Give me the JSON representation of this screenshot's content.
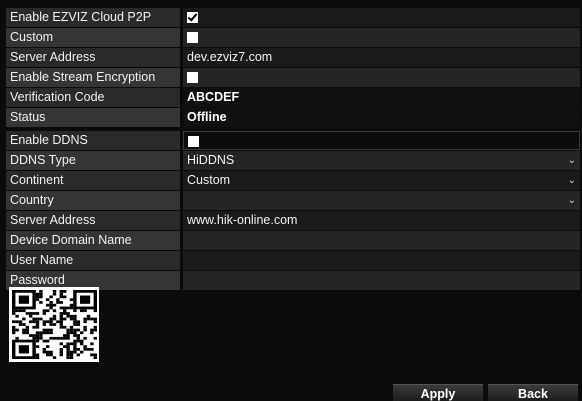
{
  "p2p": {
    "enable_label": "Enable EZVIZ Cloud P2P",
    "enable_checked": true,
    "custom_label": "Custom",
    "custom_checked": false,
    "server_label": "Server Address",
    "server_value": "dev.ezviz7.com",
    "encrypt_label": "Enable Stream Encryption",
    "encrypt_checked": false,
    "verify_label": "Verification Code",
    "verify_value": "ABCDEF",
    "status_label": "Status",
    "status_value": "Offline"
  },
  "ddns": {
    "enable_label": "Enable DDNS",
    "enable_checked": false,
    "type_label": "DDNS Type",
    "type_value": "HiDDNS",
    "continent_label": "Continent",
    "continent_value": "Custom",
    "country_label": "Country",
    "country_value": "",
    "server_label": "Server Address",
    "server_value": "www.hik-online.com",
    "domain_label": "Device Domain Name",
    "domain_value": "",
    "user_label": "User Name",
    "user_value": "",
    "password_label": "Password",
    "password_value": ""
  },
  "icons": {
    "dropdown": "chevron-down-icon",
    "qr": "qr-code"
  },
  "buttons": {
    "apply": "Apply",
    "back": "Back"
  }
}
